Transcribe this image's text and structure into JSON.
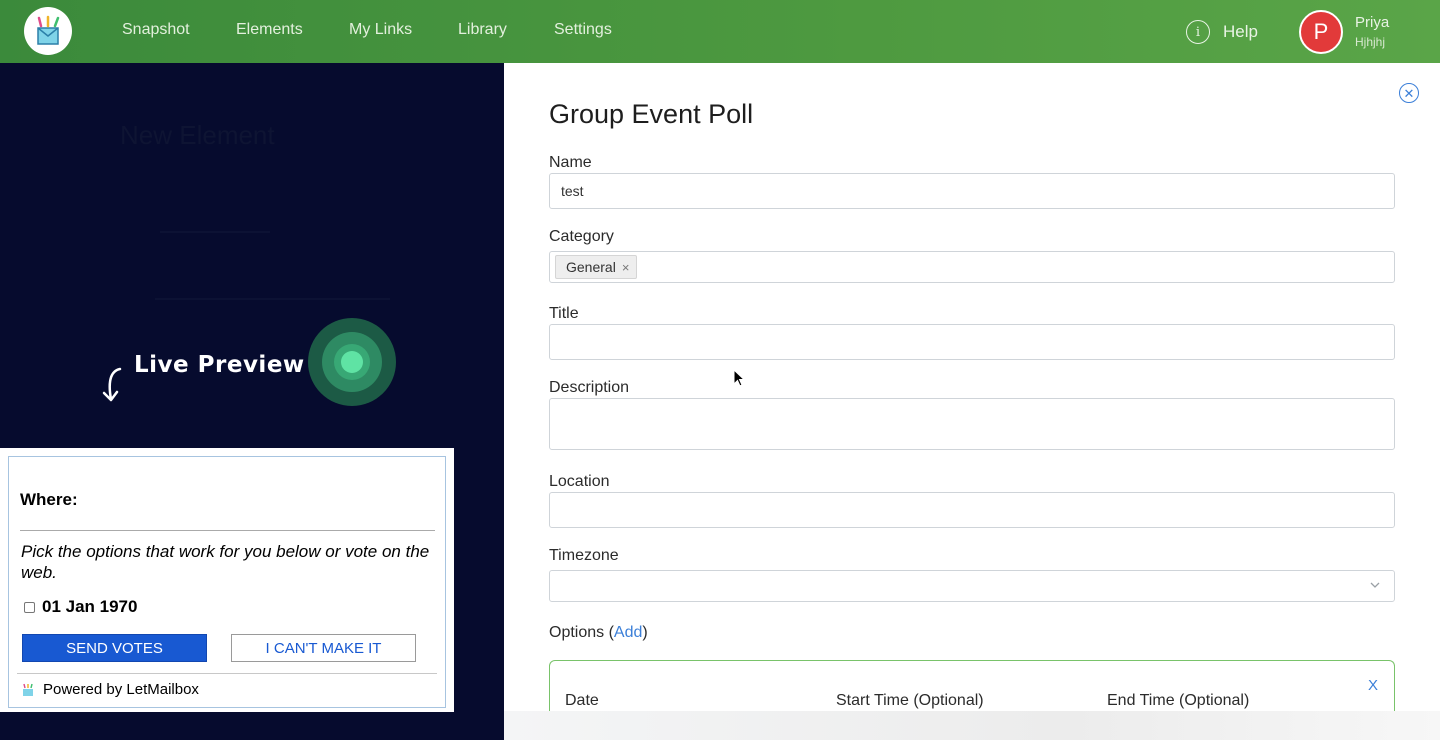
{
  "nav": {
    "items": [
      "Snapshot",
      "Elements",
      "My Links",
      "Library",
      "Settings"
    ],
    "help_label": "Help",
    "help_icon": "info-icon",
    "user": {
      "initial": "P",
      "name": "Priya",
      "subtitle": "Hjhjhj"
    }
  },
  "background": {
    "ghost_title": "New Element"
  },
  "live_preview": {
    "label": "Live Preview",
    "widget": {
      "where_label": "Where:",
      "instructions": "Pick the options that work for you below or vote on the web.",
      "option_date": "01 Jan 1970",
      "send_button": "SEND VOTES",
      "cant_button": "I CAN'T MAKE IT",
      "powered_by": "Powered by LetMailbox"
    }
  },
  "form": {
    "title": "Group Event Poll",
    "close_icon": "close-circle-icon",
    "name": {
      "label": "Name",
      "value": "test"
    },
    "category": {
      "label": "Category",
      "tags": [
        "General"
      ]
    },
    "title_field": {
      "label": "Title",
      "value": ""
    },
    "description": {
      "label": "Description",
      "value": ""
    },
    "location": {
      "label": "Location",
      "value": ""
    },
    "timezone": {
      "label": "Timezone",
      "value": ""
    },
    "options": {
      "label_prefix": "Options (",
      "add_link": "Add",
      "label_suffix": ")",
      "columns": [
        "Date",
        "Start Time (Optional)",
        "End Time (Optional)"
      ],
      "remove_label": "X"
    }
  },
  "colors": {
    "nav_green": "#4e9a40",
    "overlay_navy": "#060b2e",
    "primary_blue": "#1859d2",
    "link_blue": "#3b7fd8",
    "options_border_green": "#79c36a",
    "avatar_red": "#e23a3a"
  }
}
